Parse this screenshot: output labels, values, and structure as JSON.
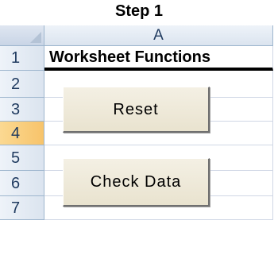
{
  "title": "Step 1",
  "sheet": {
    "corner": "",
    "column_header": "A",
    "rows": [
      {
        "label": "1",
        "cell": "Worksheet Functions"
      },
      {
        "label": "2",
        "cell": ""
      },
      {
        "label": "3",
        "cell": ""
      },
      {
        "label": "4",
        "cell": "",
        "selected": true
      },
      {
        "label": "5",
        "cell": ""
      },
      {
        "label": "6",
        "cell": ""
      },
      {
        "label": "7",
        "cell": ""
      }
    ]
  },
  "buttons": {
    "reset": "Reset",
    "check_data": "Check Data"
  },
  "colors": {
    "header_bg": "#dbe4ef",
    "selected_row_bg": "#f7c36a",
    "button_face": "#ece8d8",
    "gridline": "#d0d7e5"
  }
}
